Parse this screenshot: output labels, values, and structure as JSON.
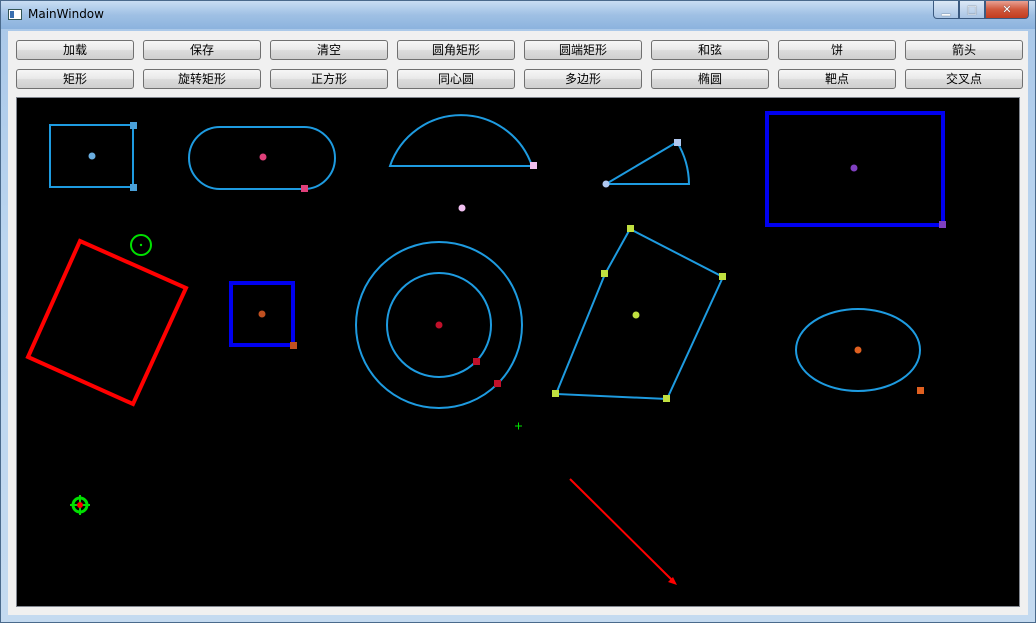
{
  "window": {
    "title": "MainWindow"
  },
  "caption": {
    "minimize_glyph": "▁",
    "maximize_glyph": "□",
    "close_glyph": "✕"
  },
  "toolbar": {
    "row1": [
      {
        "name": "load-button",
        "label": "加载"
      },
      {
        "name": "save-button",
        "label": "保存"
      },
      {
        "name": "clear-button",
        "label": "清空"
      },
      {
        "name": "rounded-rect-button",
        "label": "圆角矩形"
      },
      {
        "name": "round-end-rect-button",
        "label": "圆端矩形"
      },
      {
        "name": "chord-button",
        "label": "和弦"
      },
      {
        "name": "pie-button",
        "label": "饼"
      },
      {
        "name": "arrow-button",
        "label": "箭头"
      }
    ],
    "row2": [
      {
        "name": "rectangle-button",
        "label": "矩形"
      },
      {
        "name": "rotated-rect-button",
        "label": "旋转矩形"
      },
      {
        "name": "square-button",
        "label": "正方形"
      },
      {
        "name": "concentric-circle-button",
        "label": "同心圆"
      },
      {
        "name": "polygon-button",
        "label": "多边形"
      },
      {
        "name": "ellipse-button",
        "label": "椭圆"
      },
      {
        "name": "target-point-button",
        "label": "靶点"
      },
      {
        "name": "cross-point-button",
        "label": "交叉点"
      }
    ]
  },
  "colors": {
    "canvas_bg": "#000000",
    "shape_cyan": "#1e9be0",
    "shape_blue": "#0000f0",
    "shape_red": "#ff0000",
    "shape_green": "#00e000"
  }
}
